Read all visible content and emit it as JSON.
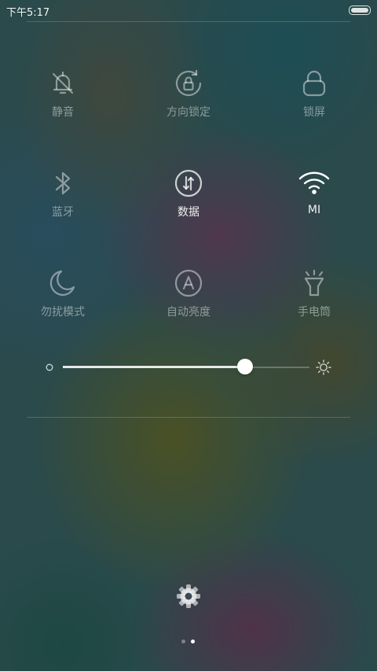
{
  "status_bar": {
    "time": "下午5:17",
    "battery_icon": "battery-full-icon"
  },
  "tiles": [
    {
      "label": "静音",
      "icon": "bell-off-icon",
      "active": false
    },
    {
      "label": "方向锁定",
      "icon": "rotation-lock-icon",
      "active": false
    },
    {
      "label": "锁屏",
      "icon": "lock-icon",
      "active": false
    },
    {
      "label": "蓝牙",
      "icon": "bluetooth-icon",
      "active": false
    },
    {
      "label": "数据",
      "icon": "mobile-data-icon",
      "active": true
    },
    {
      "label": "MI",
      "icon": "wifi-icon",
      "active": true
    },
    {
      "label": "勿扰模式",
      "icon": "moon-icon",
      "active": false
    },
    {
      "label": "自动亮度",
      "icon": "auto-brightness-icon",
      "active": false
    },
    {
      "label": "手电筒",
      "icon": "flashlight-icon",
      "active": false
    }
  ],
  "brightness": {
    "level": 0.74,
    "min_icon": "brightness-low-icon",
    "max_icon": "brightness-high-icon"
  },
  "settings_icon": "gear-icon",
  "pager": {
    "pages": 2,
    "current": 2
  },
  "colors": {
    "active": "#ffffff",
    "inactive": "#8a9a98"
  }
}
